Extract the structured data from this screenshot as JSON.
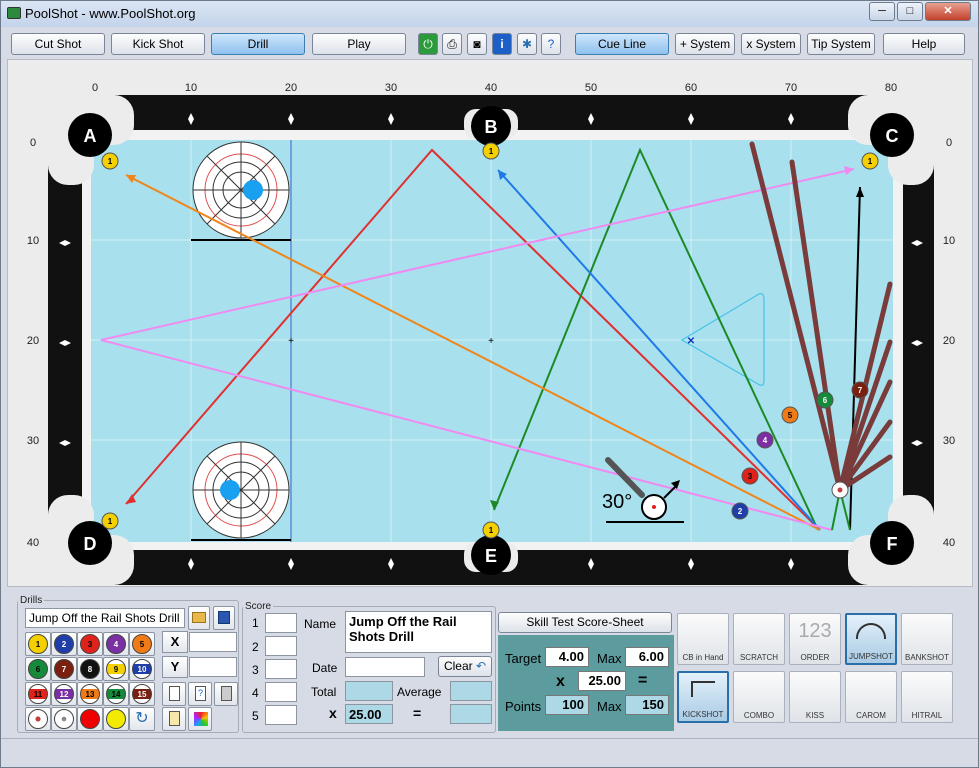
{
  "window": {
    "title": "PoolShot - www.PoolShot.org"
  },
  "toolbar": {
    "cut_shot": "Cut Shot",
    "kick_shot": "Kick Shot",
    "drill": "Drill",
    "play": "Play",
    "cue_line": "Cue Line",
    "plus_system": "+ System",
    "x_system": "x System",
    "tip_system": "Tip System",
    "help": "Help"
  },
  "table": {
    "x_ticks": [
      "0",
      "10",
      "20",
      "30",
      "40",
      "50",
      "60",
      "70",
      "80"
    ],
    "y_ticks": [
      "0",
      "10",
      "20",
      "30",
      "40"
    ],
    "pockets": [
      "A",
      "B",
      "C",
      "D",
      "E",
      "F"
    ],
    "angle_label": "30°",
    "ball_labels": {
      "one": "1",
      "two": "2",
      "three": "3",
      "four": "4",
      "five": "5",
      "six": "6",
      "seven": "7"
    }
  },
  "drills": {
    "legend": "Drills",
    "name": "Jump Off the Rail Shots Drill",
    "balls": [
      "1",
      "2",
      "3",
      "4",
      "5",
      "6",
      "7",
      "8",
      "9",
      "10",
      "11",
      "12",
      "13",
      "14",
      "15"
    ],
    "ball_colors": {
      "1": "#f5d000",
      "2": "#1f3ea8",
      "3": "#e0231a",
      "4": "#7a2fa3",
      "5": "#f07b16",
      "6": "#148a3a",
      "7": "#7a2010",
      "8": "#111111",
      "9": "#f5d000",
      "10": "#1f3ea8",
      "11": "#e0231a",
      "12": "#7a2fa3",
      "13": "#f07b16",
      "14": "#148a3a",
      "15": "#7a2010"
    },
    "x_label": "X",
    "y_label": "Y"
  },
  "score": {
    "legend": "Score",
    "rows": [
      "1",
      "2",
      "3",
      "4",
      "5"
    ],
    "name_label": "Name",
    "name_value": "Jump Off the Rail Shots Drill",
    "date_label": "Date",
    "clear_label": "Clear",
    "total_label": "Total",
    "average_label": "Average",
    "x_label": "x",
    "x_value": "25.00",
    "eq_label": "="
  },
  "skill": {
    "sheet_button": "Skill Test Score-Sheet",
    "target_label": "Target",
    "target_value": "4.00",
    "max_label": "Max",
    "max_value": "6.00",
    "x_label": "x",
    "x_value": "25.00",
    "eq_label": "=",
    "points_label": "Points",
    "points_value": "100",
    "max2_label": "Max",
    "max2_value": "150"
  },
  "shot_types": [
    "CB in Hand",
    "SCRATCH",
    "ORDER",
    "JUMPSHOT",
    "BANKSHOT",
    "KICKSHOT",
    "COMBO",
    "KISS",
    "CAROM",
    "HITRAIL"
  ],
  "colors": {
    "accent": "#3c7fb1",
    "felt": "#a8e0ee",
    "rail": "#111111"
  }
}
